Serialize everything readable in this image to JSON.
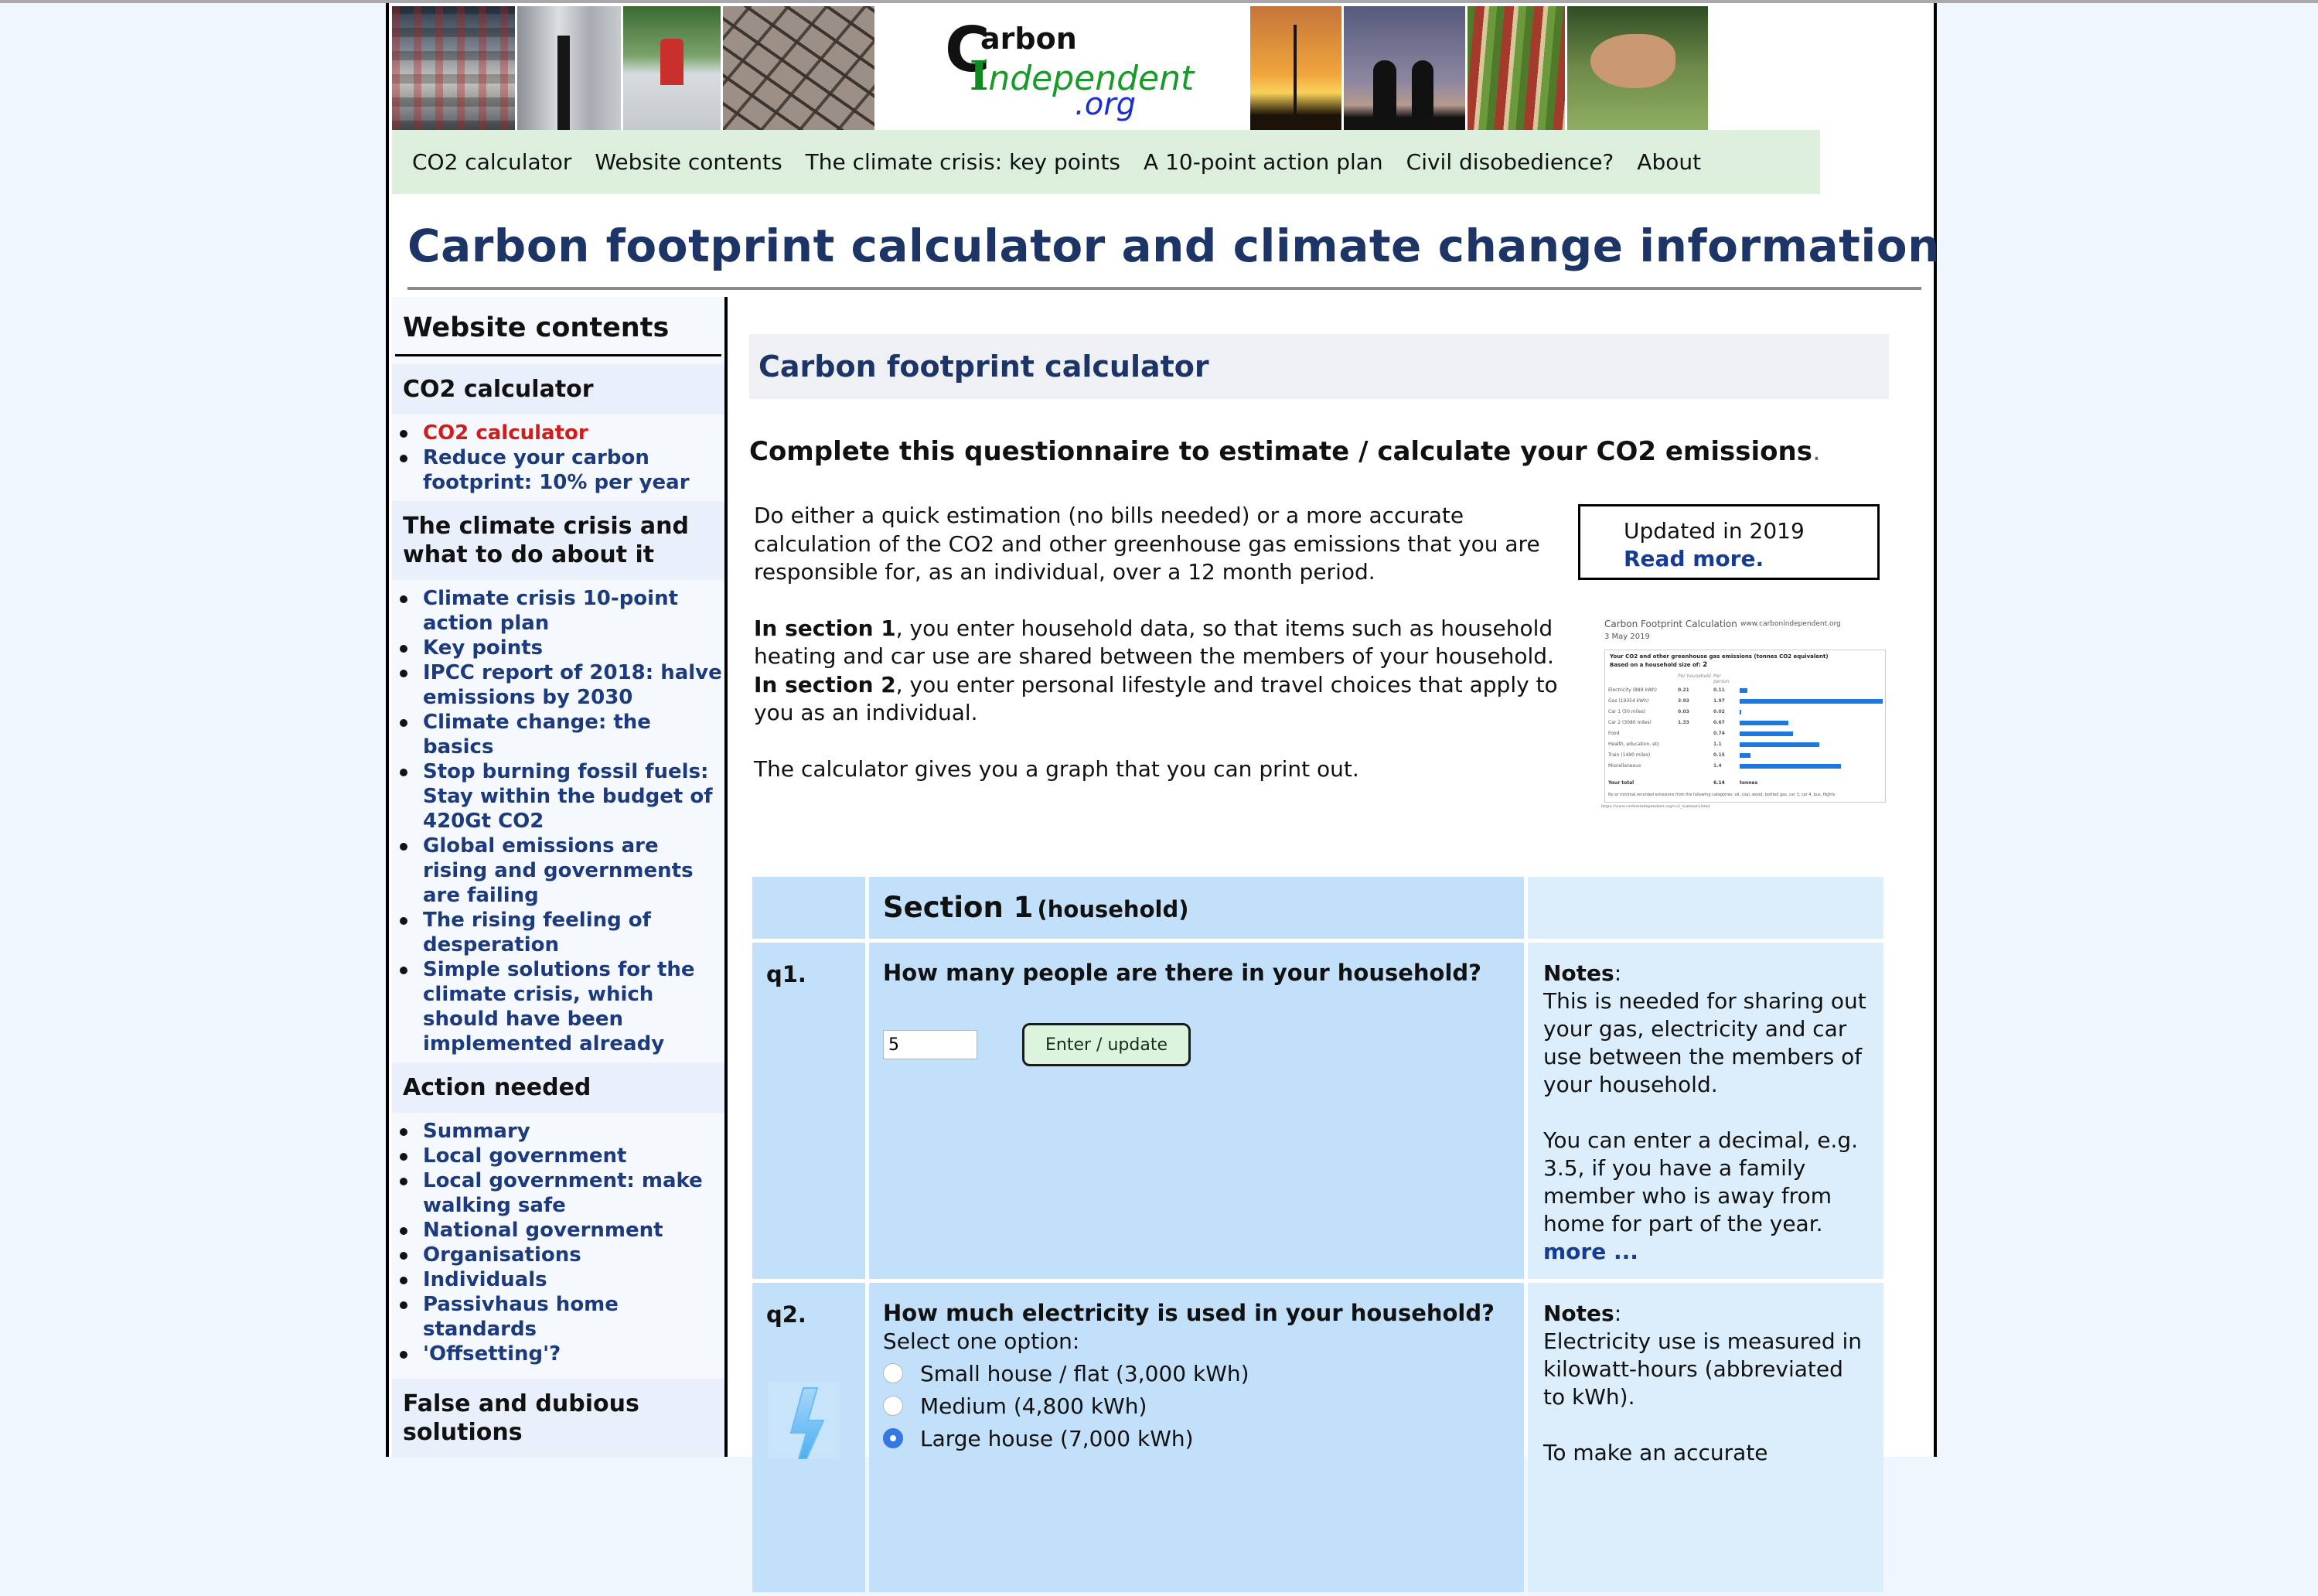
{
  "header": {
    "logo": {
      "line1_initial": "C",
      "line1_rest": "arbon",
      "line2_initial": "I",
      "line2_rest": "ndependent",
      "line3": ".org"
    },
    "banner_photos": [
      "traffic-jam-photo",
      "smokestack-photo",
      "flooded-phone-box-photo",
      "cracked-earth-photo",
      "wind-turbine-photo",
      "cyclists-silhouette-photo",
      "rhubarb-photo",
      "chicken-photo"
    ]
  },
  "topnav": [
    {
      "label": "CO2 calculator"
    },
    {
      "label": "Website contents"
    },
    {
      "label": "The climate crisis: key points"
    },
    {
      "label": "A 10-point action plan"
    },
    {
      "label": "Civil disobedience?"
    },
    {
      "label": "About"
    }
  ],
  "site_title": "Carbon footprint calculator and climate change information",
  "sidebar": {
    "heading": "Website contents",
    "sections": [
      {
        "title": "CO2 calculator",
        "items": [
          {
            "label": "CO2 calculator",
            "active": true
          },
          {
            "label": "Reduce your carbon footprint: 10% per year"
          }
        ]
      },
      {
        "title": "The climate crisis and what to do about it",
        "items": [
          {
            "label": "Climate crisis 10-point action plan"
          },
          {
            "label": "Key points"
          },
          {
            "label": "IPCC report of 2018: halve emissions by 2030"
          },
          {
            "label": "Climate change: the basics"
          },
          {
            "label": "Stop burning fossil fuels: Stay within the budget of 420Gt CO2"
          },
          {
            "label": "Global emissions are rising and governments are failing"
          },
          {
            "label": "The rising feeling of desperation"
          },
          {
            "label": "Simple solutions for the climate crisis, which should have been implemented already"
          }
        ]
      },
      {
        "title": "Action needed",
        "items": [
          {
            "label": "Summary"
          },
          {
            "label": "Local government"
          },
          {
            "label": "Local government: make walking safe"
          },
          {
            "label": "National government"
          },
          {
            "label": "Organisations"
          },
          {
            "label": "Individuals"
          },
          {
            "label": "Passivhaus home standards"
          },
          {
            "label": "'Offsetting'?"
          }
        ]
      },
      {
        "title": "False and dubious solutions",
        "items": []
      }
    ]
  },
  "main": {
    "calc_title": "Carbon footprint calculator",
    "intro_heading": "Complete this questionnaire to estimate / calculate your CO2 emissions",
    "intro_heading_end": ".",
    "intro_p1": "Do either a quick estimation (no bills needed) or a more accurate calculation of the CO2 and other greenhouse gas emissions that you are responsible for, as an individual, over a 12 month period.",
    "intro_p2_bold1": "In section 1",
    "intro_p2_text1": ", you enter household data, so that items such as household heating and car use are shared between the members of your household.",
    "intro_p2_bold2": "In section 2",
    "intro_p2_text2": ", you enter personal lifestyle and travel choices that apply to you as an individual.",
    "intro_p3": "The calculator gives you a graph that you can print out.",
    "update_box": {
      "text": "Updated in 2019",
      "link": "Read more."
    },
    "thumbnail": {
      "title": "Carbon Footprint Calculation",
      "site": "www.carbonindependent.org",
      "date": "3 May 2019",
      "heading": "Your CO2 and other greenhouse gas emissions (tonnes CO2 equivalent)",
      "household_label": "Based on a household size of:",
      "household_size": "2",
      "col_household": "Per household",
      "col_person": "Per person",
      "rows": [
        {
          "label": "Electricity (889 kWh)",
          "household": "0.21",
          "person": "0.11",
          "value": 0.11
        },
        {
          "label": "Gas (19354 kWh)",
          "household": "3.93",
          "person": "1.97",
          "value": 1.97
        },
        {
          "label": "Car 1 (50 miles)",
          "household": "0.03",
          "person": "0.02",
          "value": 0.02
        },
        {
          "label": "Car 2 (3080 miles)",
          "household": "1.33",
          "person": "0.67",
          "value": 0.67
        },
        {
          "label": "Food",
          "household": "",
          "person": "0.74",
          "value": 0.74
        },
        {
          "label": "Health, education, etc",
          "household": "",
          "person": "1.1",
          "value": 1.1
        },
        {
          "label": "Train (1490 miles)",
          "household": "",
          "person": "0.15",
          "value": 0.15
        },
        {
          "label": "Miscellaneous",
          "household": "",
          "person": "1.4",
          "value": 1.4
        }
      ],
      "total_label": "Your total",
      "total_value": "6.14",
      "total_unit": "tonnes",
      "footnote": "No or minimal recorded emissions from the following categories: oil, coal, wood, bottled gas, car 3, car 4, bus, flights",
      "url": "https://www.carbonindependent.org/co2_summary.html"
    },
    "section1": {
      "title": "Section 1",
      "subtitle": "(household)"
    },
    "q1": {
      "num": "q1.",
      "question": "How many people are there in your household?",
      "input_value": "5",
      "button": "Enter / update",
      "notes_label": "Notes",
      "notes_p1": "This is needed for sharing out your gas, electricity and car use between the members of your household.",
      "notes_p2": "You can enter a decimal, e.g. 3.5, if you have a family member who is away from home for part of the year.",
      "more": "more ..."
    },
    "q2": {
      "num": "q2.",
      "question": "How much electricity is used in your household?",
      "select_label": "Select one option:",
      "options": [
        {
          "label": "Small house / flat (3,000 kWh)",
          "selected": false
        },
        {
          "label": "Medium (4,800 kWh)",
          "selected": false
        },
        {
          "label": "Large house (7,000 kWh)",
          "selected": true
        }
      ],
      "notes_label": "Notes",
      "notes_p1": "Electricity use is measured in kilowatt-hours (abbreviated to kWh).",
      "notes_p2": "To make an accurate"
    }
  },
  "colors": {
    "title_navy": "#1c3566",
    "link_blue": "#1c3a7e",
    "active_red": "#d21c1c",
    "nav_green": "#dcefdc",
    "table_blue": "#c2e0fa",
    "notes_blue": "#dcedfc",
    "bar_blue": "#1f78e0"
  }
}
